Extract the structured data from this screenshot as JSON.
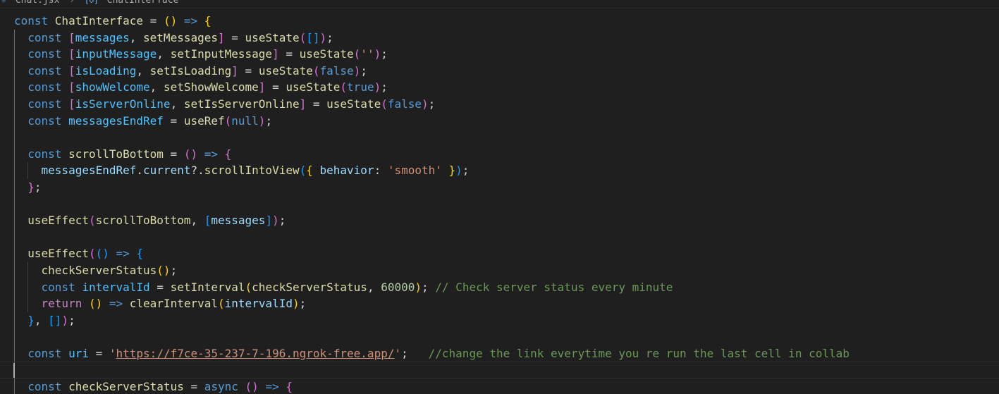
{
  "breadcrumb": {
    "file": "Chat.jsx",
    "symbol": "ChatInterface"
  },
  "code": {
    "lines": [
      [
        {
          "t": "const ",
          "c": "kw"
        },
        {
          "t": "ChatInterface",
          "c": "fn"
        },
        {
          "t": " = ",
          "c": "punc"
        },
        {
          "t": "()",
          "c": "b1"
        },
        {
          "t": " ",
          "c": "punc"
        },
        {
          "t": "=>",
          "c": "kw"
        },
        {
          "t": " ",
          "c": "punc"
        },
        {
          "t": "{",
          "c": "b1"
        }
      ],
      [
        {
          "t": "  ",
          "c": "punc"
        },
        {
          "t": "const ",
          "c": "kw"
        },
        {
          "t": "[",
          "c": "b2"
        },
        {
          "t": "messages",
          "c": "const"
        },
        {
          "t": ", ",
          "c": "punc"
        },
        {
          "t": "setMessages",
          "c": "fn"
        },
        {
          "t": "]",
          "c": "b2"
        },
        {
          "t": " = ",
          "c": "punc"
        },
        {
          "t": "useState",
          "c": "fn"
        },
        {
          "t": "(",
          "c": "b2"
        },
        {
          "t": "[]",
          "c": "b3"
        },
        {
          "t": ")",
          "c": "b2"
        },
        {
          "t": ";",
          "c": "punc"
        }
      ],
      [
        {
          "t": "  ",
          "c": "punc"
        },
        {
          "t": "const ",
          "c": "kw"
        },
        {
          "t": "[",
          "c": "b2"
        },
        {
          "t": "inputMessage",
          "c": "const"
        },
        {
          "t": ", ",
          "c": "punc"
        },
        {
          "t": "setInputMessage",
          "c": "fn"
        },
        {
          "t": "]",
          "c": "b2"
        },
        {
          "t": " = ",
          "c": "punc"
        },
        {
          "t": "useState",
          "c": "fn"
        },
        {
          "t": "(",
          "c": "b2"
        },
        {
          "t": "''",
          "c": "str"
        },
        {
          "t": ")",
          "c": "b2"
        },
        {
          "t": ";",
          "c": "punc"
        }
      ],
      [
        {
          "t": "  ",
          "c": "punc"
        },
        {
          "t": "const ",
          "c": "kw"
        },
        {
          "t": "[",
          "c": "b2"
        },
        {
          "t": "isLoading",
          "c": "const"
        },
        {
          "t": ", ",
          "c": "punc"
        },
        {
          "t": "setIsLoading",
          "c": "fn"
        },
        {
          "t": "]",
          "c": "b2"
        },
        {
          "t": " = ",
          "c": "punc"
        },
        {
          "t": "useState",
          "c": "fn"
        },
        {
          "t": "(",
          "c": "b2"
        },
        {
          "t": "false",
          "c": "kw"
        },
        {
          "t": ")",
          "c": "b2"
        },
        {
          "t": ";",
          "c": "punc"
        }
      ],
      [
        {
          "t": "  ",
          "c": "punc"
        },
        {
          "t": "const ",
          "c": "kw"
        },
        {
          "t": "[",
          "c": "b2"
        },
        {
          "t": "showWelcome",
          "c": "const"
        },
        {
          "t": ", ",
          "c": "punc"
        },
        {
          "t": "setShowWelcome",
          "c": "fn"
        },
        {
          "t": "]",
          "c": "b2"
        },
        {
          "t": " = ",
          "c": "punc"
        },
        {
          "t": "useState",
          "c": "fn"
        },
        {
          "t": "(",
          "c": "b2"
        },
        {
          "t": "true",
          "c": "kw"
        },
        {
          "t": ")",
          "c": "b2"
        },
        {
          "t": ";",
          "c": "punc"
        }
      ],
      [
        {
          "t": "  ",
          "c": "punc"
        },
        {
          "t": "const ",
          "c": "kw"
        },
        {
          "t": "[",
          "c": "b2"
        },
        {
          "t": "isServerOnline",
          "c": "const"
        },
        {
          "t": ", ",
          "c": "punc"
        },
        {
          "t": "setIsServerOnline",
          "c": "fn"
        },
        {
          "t": "]",
          "c": "b2"
        },
        {
          "t": " = ",
          "c": "punc"
        },
        {
          "t": "useState",
          "c": "fn"
        },
        {
          "t": "(",
          "c": "b2"
        },
        {
          "t": "false",
          "c": "kw"
        },
        {
          "t": ")",
          "c": "b2"
        },
        {
          "t": ";",
          "c": "punc"
        }
      ],
      [
        {
          "t": "  ",
          "c": "punc"
        },
        {
          "t": "const ",
          "c": "kw"
        },
        {
          "t": "messagesEndRef",
          "c": "const"
        },
        {
          "t": " = ",
          "c": "punc"
        },
        {
          "t": "useRef",
          "c": "fn"
        },
        {
          "t": "(",
          "c": "b2"
        },
        {
          "t": "null",
          "c": "kw"
        },
        {
          "t": ")",
          "c": "b2"
        },
        {
          "t": ";",
          "c": "punc"
        }
      ],
      [],
      [
        {
          "t": "  ",
          "c": "punc"
        },
        {
          "t": "const ",
          "c": "kw"
        },
        {
          "t": "scrollToBottom",
          "c": "fn"
        },
        {
          "t": " = ",
          "c": "punc"
        },
        {
          "t": "()",
          "c": "b2"
        },
        {
          "t": " ",
          "c": "punc"
        },
        {
          "t": "=>",
          "c": "kw"
        },
        {
          "t": " ",
          "c": "punc"
        },
        {
          "t": "{",
          "c": "b2"
        }
      ],
      [
        {
          "t": "    ",
          "c": "punc"
        },
        {
          "t": "messagesEndRef",
          "c": "var"
        },
        {
          "t": ".",
          "c": "punc"
        },
        {
          "t": "current",
          "c": "var"
        },
        {
          "t": "?.",
          "c": "punc"
        },
        {
          "t": "scrollIntoView",
          "c": "fn"
        },
        {
          "t": "(",
          "c": "b3"
        },
        {
          "t": "{ ",
          "c": "b1"
        },
        {
          "t": "behavior",
          "c": "var"
        },
        {
          "t": ": ",
          "c": "punc"
        },
        {
          "t": "'smooth'",
          "c": "str"
        },
        {
          "t": " }",
          "c": "b1"
        },
        {
          "t": ")",
          "c": "b3"
        },
        {
          "t": ";",
          "c": "punc"
        }
      ],
      [
        {
          "t": "  ",
          "c": "punc"
        },
        {
          "t": "}",
          "c": "b2"
        },
        {
          "t": ";",
          "c": "punc"
        }
      ],
      [],
      [
        {
          "t": "  ",
          "c": "punc"
        },
        {
          "t": "useEffect",
          "c": "fn"
        },
        {
          "t": "(",
          "c": "b2"
        },
        {
          "t": "scrollToBottom",
          "c": "fn"
        },
        {
          "t": ", ",
          "c": "punc"
        },
        {
          "t": "[",
          "c": "b3"
        },
        {
          "t": "messages",
          "c": "var"
        },
        {
          "t": "]",
          "c": "b3"
        },
        {
          "t": ")",
          "c": "b2"
        },
        {
          "t": ";",
          "c": "punc"
        }
      ],
      [],
      [
        {
          "t": "  ",
          "c": "punc"
        },
        {
          "t": "useEffect",
          "c": "fn"
        },
        {
          "t": "(",
          "c": "b2"
        },
        {
          "t": "()",
          "c": "b3"
        },
        {
          "t": " ",
          "c": "punc"
        },
        {
          "t": "=>",
          "c": "kw"
        },
        {
          "t": " ",
          "c": "punc"
        },
        {
          "t": "{",
          "c": "b3"
        }
      ],
      [
        {
          "t": "    ",
          "c": "punc"
        },
        {
          "t": "checkServerStatus",
          "c": "fn"
        },
        {
          "t": "()",
          "c": "b1"
        },
        {
          "t": ";",
          "c": "punc"
        }
      ],
      [
        {
          "t": "    ",
          "c": "punc"
        },
        {
          "t": "const ",
          "c": "kw"
        },
        {
          "t": "intervalId",
          "c": "const"
        },
        {
          "t": " = ",
          "c": "punc"
        },
        {
          "t": "setInterval",
          "c": "fn"
        },
        {
          "t": "(",
          "c": "b1"
        },
        {
          "t": "checkServerStatus",
          "c": "fn"
        },
        {
          "t": ", ",
          "c": "punc"
        },
        {
          "t": "60000",
          "c": "num"
        },
        {
          "t": ")",
          "c": "b1"
        },
        {
          "t": "; ",
          "c": "punc"
        },
        {
          "t": "// Check server status every minute",
          "c": "com"
        }
      ],
      [
        {
          "t": "    ",
          "c": "punc"
        },
        {
          "t": "return ",
          "c": "ctrl"
        },
        {
          "t": "()",
          "c": "b1"
        },
        {
          "t": " ",
          "c": "punc"
        },
        {
          "t": "=>",
          "c": "kw"
        },
        {
          "t": " ",
          "c": "punc"
        },
        {
          "t": "clearInterval",
          "c": "fn"
        },
        {
          "t": "(",
          "c": "b1"
        },
        {
          "t": "intervalId",
          "c": "var"
        },
        {
          "t": ")",
          "c": "b1"
        },
        {
          "t": ";",
          "c": "punc"
        }
      ],
      [
        {
          "t": "  ",
          "c": "punc"
        },
        {
          "t": "}",
          "c": "b3"
        },
        {
          "t": ", ",
          "c": "punc"
        },
        {
          "t": "[]",
          "c": "b3"
        },
        {
          "t": ")",
          "c": "b2"
        },
        {
          "t": ";",
          "c": "punc"
        }
      ],
      [],
      [
        {
          "t": "  ",
          "c": "punc"
        },
        {
          "t": "const ",
          "c": "kw"
        },
        {
          "t": "uri",
          "c": "const"
        },
        {
          "t": " = ",
          "c": "punc"
        },
        {
          "t": "'",
          "c": "str"
        },
        {
          "t": "https://f7ce-35-237-7-196.ngrok-free.app/",
          "c": "str link"
        },
        {
          "t": "'",
          "c": "str"
        },
        {
          "t": ";   ",
          "c": "punc"
        },
        {
          "t": "//change the link everytime you re run the last cell in collab",
          "c": "com"
        }
      ],
      [],
      [
        {
          "t": "  ",
          "c": "punc"
        },
        {
          "t": "const ",
          "c": "kw"
        },
        {
          "t": "checkServerStatus",
          "c": "fn"
        },
        {
          "t": " = ",
          "c": "punc"
        },
        {
          "t": "async ",
          "c": "kw"
        },
        {
          "t": "()",
          "c": "b2"
        },
        {
          "t": " ",
          "c": "punc"
        },
        {
          "t": "=>",
          "c": "kw"
        },
        {
          "t": " ",
          "c": "punc"
        },
        {
          "t": "{",
          "c": "b2"
        }
      ]
    ]
  },
  "colors": {
    "background": "#1f1f1f",
    "keyword": "#569cd6",
    "function": "#dcdcaa",
    "variable": "#9cdcfe",
    "constant": "#4fc1ff",
    "string": "#ce9178",
    "number": "#b5cea8",
    "comment": "#6a9955",
    "bracket_gold": "#ffd700",
    "bracket_orchid": "#da70d6",
    "bracket_blue": "#179fff"
  }
}
